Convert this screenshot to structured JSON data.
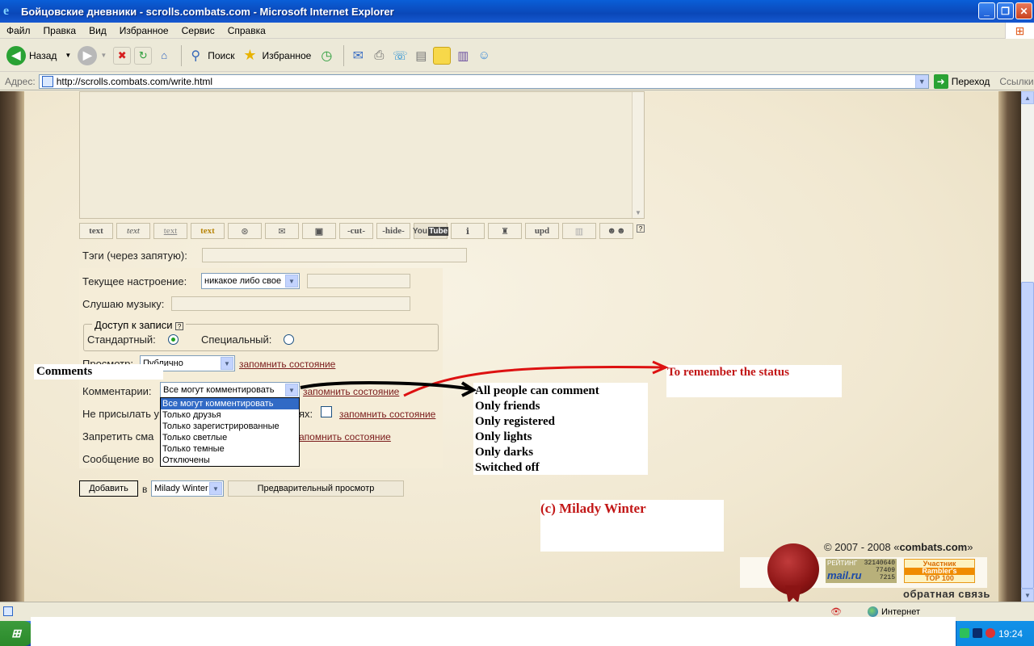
{
  "window": {
    "title": "Бойцовские дневники - scrolls.combats.com - Microsoft Internet Explorer"
  },
  "menu": [
    "Файл",
    "Правка",
    "Вид",
    "Избранное",
    "Сервис",
    "Справка"
  ],
  "toolbar": {
    "back": "Назад",
    "search": "Поиск",
    "favorites": "Избранное"
  },
  "address": {
    "label": "Адрес:",
    "url": "http://scrolls.combats.com/write.html",
    "go": "Переход",
    "links": "Ссылки"
  },
  "format_buttons": [
    "text",
    "text",
    "text",
    "text",
    "",
    "",
    "",
    "-cut-",
    "-hide-",
    "YouTube",
    "",
    "",
    "upd",
    "",
    ""
  ],
  "form": {
    "tags_label": "Тэги (через запятую):",
    "mood_label": "Текущее настроение:",
    "mood_value": "никакое либо свое",
    "music_label": "Слушаю музыку:",
    "access_legend": "Доступ к записи",
    "access_standard": "Стандартный:",
    "access_special": "Специальный:",
    "view_label": "Просмотр:",
    "view_value": "Публично",
    "remember": "запомнить состояние",
    "comments_label": "Комментарии:",
    "comments_value": "Все могут комментировать",
    "comments_options": [
      "Все могут комментировать",
      "Только друзья",
      "Только зарегистрированные",
      "Только светлые",
      "Только темные",
      "Отключены"
    ],
    "no_send_label": "Не присылать у",
    "no_send_tail": "ях:",
    "forbid_label": "Запретить сма",
    "forbid_link": "апомнить состояние",
    "message_label": "Сообщение во",
    "add_button": "Добавить",
    "in_label": "в",
    "author_value": "Milady Winter",
    "preview_button": "Предварительный просмотр"
  },
  "annotations": {
    "comments_title": "Comments",
    "remember_status": "To remember the status",
    "options_en": [
      "All people can comment",
      "Only friends",
      "Only registered",
      "Only lights",
      "Only darks",
      "Switched off"
    ],
    "credit": "(c) Milady Winter"
  },
  "footer": {
    "copyright_prefix": "© 2007 - 2008 «",
    "copyright_site": "combats.com",
    "copyright_suffix": "»",
    "feedback": "обратная связь",
    "counter_rating": "РЕЙТИНГ",
    "counter_nums": [
      "32140640",
      "77409",
      "7215"
    ],
    "counter_mail": "mail.ru",
    "rambler_top": "Участник",
    "rambler_mid": "Rambler's",
    "rambler_bot": "TOP 100"
  },
  "status": {
    "zone": "Интернет"
  },
  "taskbar": {
    "clock": "19:24"
  }
}
